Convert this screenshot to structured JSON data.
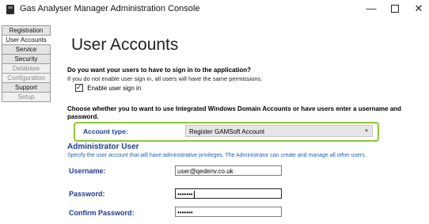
{
  "window": {
    "title": "Gas Analyser Manager Administration Console",
    "controls": {
      "minimize": "—",
      "close": "✕"
    }
  },
  "sidebar": {
    "items": [
      {
        "label": "Registration",
        "state": "normal"
      },
      {
        "label": "User Accounts",
        "state": "active"
      },
      {
        "label": "Service",
        "state": "normal"
      },
      {
        "label": "Security",
        "state": "normal"
      },
      {
        "label": "Database",
        "state": "disabled"
      },
      {
        "label": "Configuration",
        "state": "disabled"
      },
      {
        "label": "Support",
        "state": "normal"
      },
      {
        "label": "Setup",
        "state": "disabled"
      }
    ]
  },
  "main": {
    "title": "User Accounts",
    "signin_question": "Do you want your users to have to sign in to the application?",
    "signin_note": "If you do not enable user sign in, all users will have the same permissions.",
    "enable_signin": {
      "label": "Enable user sign in",
      "checked": true,
      "check_glyph": "✓"
    },
    "account_question": "Choose whether you to want to use Integrated Windows Domain Accounts or have users enter a username and password.",
    "account_type": {
      "label": "Account type:",
      "selected": "Register GAMSoft Account",
      "arrow": "▼",
      "highlight_color": "#8dc63f"
    },
    "admin": {
      "heading": "Administrator User",
      "description": "Specify the user account that will have administrative privileges. The Administrator can create and manage all other users.",
      "username_label": "Username:",
      "username_value": "user@qedenv.co.uk",
      "password_label": "Password:",
      "password_value": "•••••••",
      "confirm_label": "Confirm Password:",
      "confirm_value": "•••••••"
    }
  },
  "colors": {
    "accent_blue": "#1f3a93",
    "note_blue": "#1f5fb0",
    "highlight_green": "#8dc63f"
  }
}
